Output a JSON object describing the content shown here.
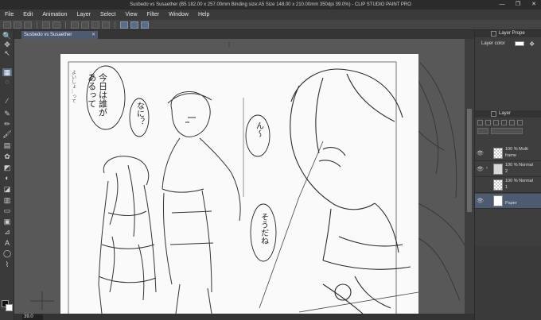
{
  "window": {
    "title": "Susbedo vs Susaether (B5 182.00 x 257.00mm Binding size:A5 Size 148.00 x 210.00mm 350dpi 39.0%) - CLIP STUDIO PAINT PRO",
    "controls": [
      "—",
      "❐",
      "✕"
    ]
  },
  "menu": [
    "File",
    "Edit",
    "Animation",
    "Layer",
    "Select",
    "View",
    "Filter",
    "Window",
    "Help"
  ],
  "document_tab": {
    "label": "Susbedo vs Susaether",
    "close": "✕"
  },
  "status": {
    "zoom": "39.0"
  },
  "panels": {
    "layer_property": {
      "title": "Layer Prope",
      "layer_color_label": "Layer color",
      "icon": "palette-icon"
    },
    "layer": {
      "title": "Layer",
      "layers": [
        {
          "line1": "100 % Multi",
          "line2": "frame",
          "thumb": "check",
          "eye": "👁",
          "selected": false
        },
        {
          "line1": "100 % Normal",
          "line2": "2",
          "thumb": "folder",
          "eye": "👁",
          "selected": false
        },
        {
          "line1": "100 % Normal",
          "line2": "1",
          "thumb": "check",
          "eye": "",
          "selected": false
        },
        {
          "line1": "",
          "line2": "Paper",
          "thumb": "paper",
          "eye": "👁",
          "selected": true
        }
      ]
    }
  },
  "tools": [
    {
      "name": "zoom-tool",
      "glyph": "🔍"
    },
    {
      "name": "move-tool",
      "glyph": "✥"
    },
    {
      "name": "operation-tool",
      "glyph": "↖"
    },
    {
      "name": "selection-tool",
      "glyph": "▦"
    },
    {
      "name": "lasso-tool",
      "glyph": "◌"
    },
    {
      "name": "eyedropper-tool",
      "glyph": "⁄"
    },
    {
      "name": "pen-tool",
      "glyph": "✎"
    },
    {
      "name": "pencil-tool",
      "glyph": "✏"
    },
    {
      "name": "brush-tool",
      "glyph": "🖌"
    },
    {
      "name": "airbrush-tool",
      "glyph": "▤"
    },
    {
      "name": "decoration-tool",
      "glyph": "✿"
    },
    {
      "name": "eraser-tool",
      "glyph": "◩"
    },
    {
      "name": "blend-tool",
      "glyph": "◐"
    },
    {
      "name": "fill-tool",
      "glyph": "◪"
    },
    {
      "name": "gradient-tool",
      "glyph": "▥"
    },
    {
      "name": "figure-tool",
      "glyph": "▭"
    },
    {
      "name": "frame-tool",
      "glyph": "▣"
    },
    {
      "name": "ruler-tool",
      "glyph": "⊿"
    },
    {
      "name": "text-tool",
      "glyph": "A"
    },
    {
      "name": "balloon-tool",
      "glyph": "◯"
    },
    {
      "name": "correct-line-tool",
      "glyph": "⌇"
    }
  ],
  "speech_bubbles": [
    {
      "text": "今日は誰が\nあるって"
    },
    {
      "text": "なに？"
    },
    {
      "text": "よいしょ…って"
    },
    {
      "text": "ん〜"
    },
    {
      "text": "そうだね"
    }
  ]
}
